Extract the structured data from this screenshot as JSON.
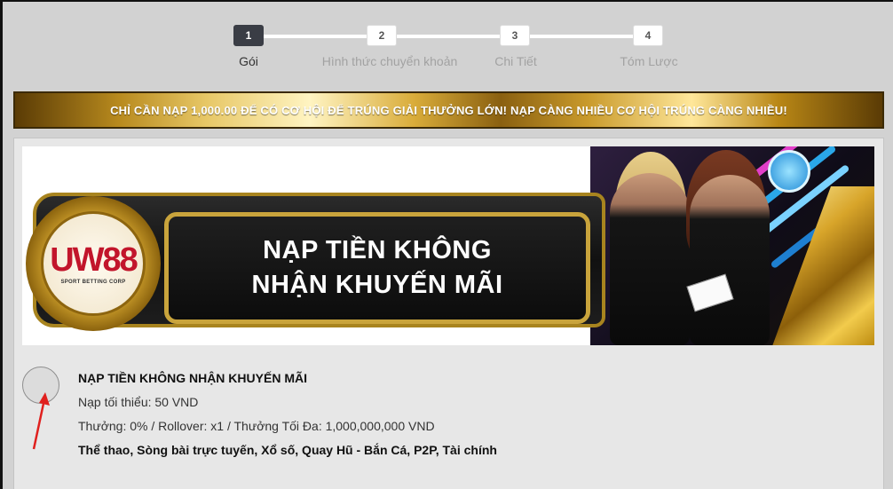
{
  "stepper": {
    "steps": [
      {
        "number": "1",
        "label": "Gói"
      },
      {
        "number": "2",
        "label": "Hình thức chuyển khoản"
      },
      {
        "number": "3",
        "label": "Chi Tiết"
      },
      {
        "number": "4",
        "label": "Tóm Lược"
      }
    ],
    "active_step": 1
  },
  "banner": {
    "text": "CHỈ CẦN NẠP 1,000.00 ĐỂ CÓ CƠ HỘI ĐỂ TRÚNG GIẢI THƯỞNG LỚN! NẠP CÀNG NHIỀU CƠ HỘI TRÚNG CÀNG NHIỀU!"
  },
  "promo_image": {
    "logo_text": "UW88",
    "logo_subtext": "SPORT BETTING CORP",
    "headline_line1": "NẠP TIỀN KHÔNG",
    "headline_line2": "NHẬN KHUYẾN MÃI"
  },
  "promo": {
    "title": "NẠP TIỀN KHÔNG NHẬN KHUYẾN MÃI",
    "min_deposit": "Nạp tối thiểu: 50 VND",
    "bonus_info": "Thưởng: 0% / Rollover: x1 / Thưởng Tối Đa: 1,000,000,000 VND",
    "categories": "Thể thao, Sòng bài trực tuyến, Xổ số, Quay Hũ - Bắn Cá, P2P, Tài chính"
  },
  "colors": {
    "active_step": "#3a3d45",
    "gold": "#d9ac3a",
    "arrow": "#e0201e"
  }
}
